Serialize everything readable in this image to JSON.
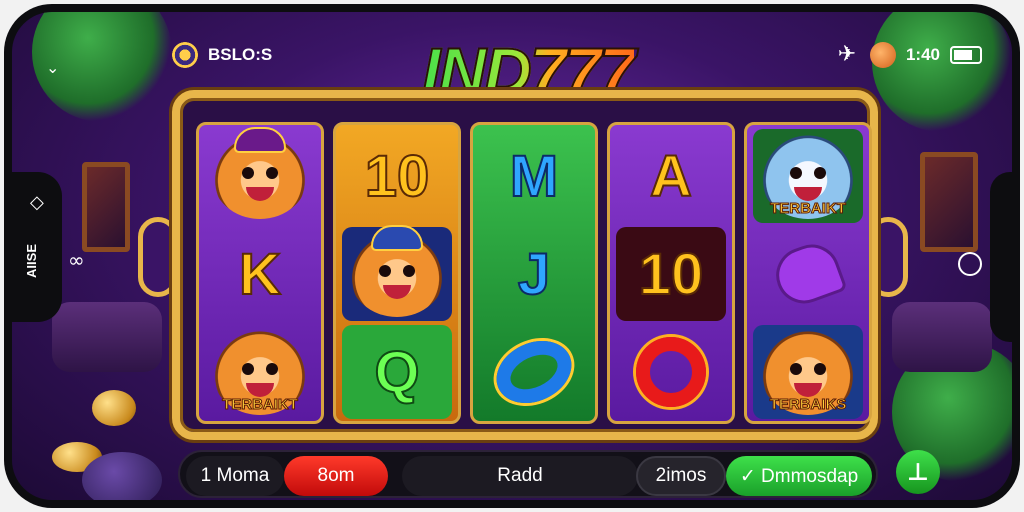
{
  "status_bar": {
    "left_text": "BSLO:S",
    "right_text": "1:40",
    "icons": [
      "target-icon",
      "airplane-icon",
      "chip-icon",
      "battery-icon"
    ]
  },
  "logo": {
    "text": "IND777"
  },
  "reels": [
    {
      "color": "purple",
      "symbols": [
        {
          "type": "tiger",
          "label": ""
        },
        {
          "type": "letter",
          "text": "K",
          "tone": "gold"
        },
        {
          "type": "tiger",
          "label": "TERBAIKT"
        }
      ]
    },
    {
      "color": "orange",
      "symbols": [
        {
          "type": "letter",
          "text": "10",
          "tone": "gold"
        },
        {
          "type": "tiger",
          "label": ""
        },
        {
          "type": "letter",
          "text": "Q",
          "tone": "lime"
        }
      ]
    },
    {
      "color": "green",
      "symbols": [
        {
          "type": "letter",
          "text": "M",
          "tone": "blue"
        },
        {
          "type": "letter",
          "text": "J",
          "tone": "blue"
        },
        {
          "type": "shape",
          "name": "blue-gold-ring-icon"
        }
      ]
    },
    {
      "color": "purple",
      "symbols": [
        {
          "type": "letter",
          "text": "A",
          "tone": "gold"
        },
        {
          "type": "letter",
          "text": "10",
          "tone": "gold"
        },
        {
          "type": "shape",
          "name": "red-ring-icon"
        }
      ]
    },
    {
      "color": "purple",
      "symbols": [
        {
          "type": "tiger",
          "label": "TERBAIKT"
        },
        {
          "type": "shape",
          "name": "purple-heart-icon"
        },
        {
          "type": "tiger",
          "label": "TERBAIKS"
        }
      ]
    }
  ],
  "controls": {
    "bet_label": "1 Moma",
    "spin_label": "8om",
    "center_label": "Radd",
    "lines_label": "2imos",
    "auto_label": "✓ Dmmosdap",
    "go_icon": "⊥"
  },
  "side": {
    "vertical_text": "AIISE"
  },
  "colors": {
    "accent_gold": "#e8b64a",
    "spin_red": "#e01a12",
    "auto_green": "#2ac83a",
    "bg_purple": "#3a1466"
  }
}
